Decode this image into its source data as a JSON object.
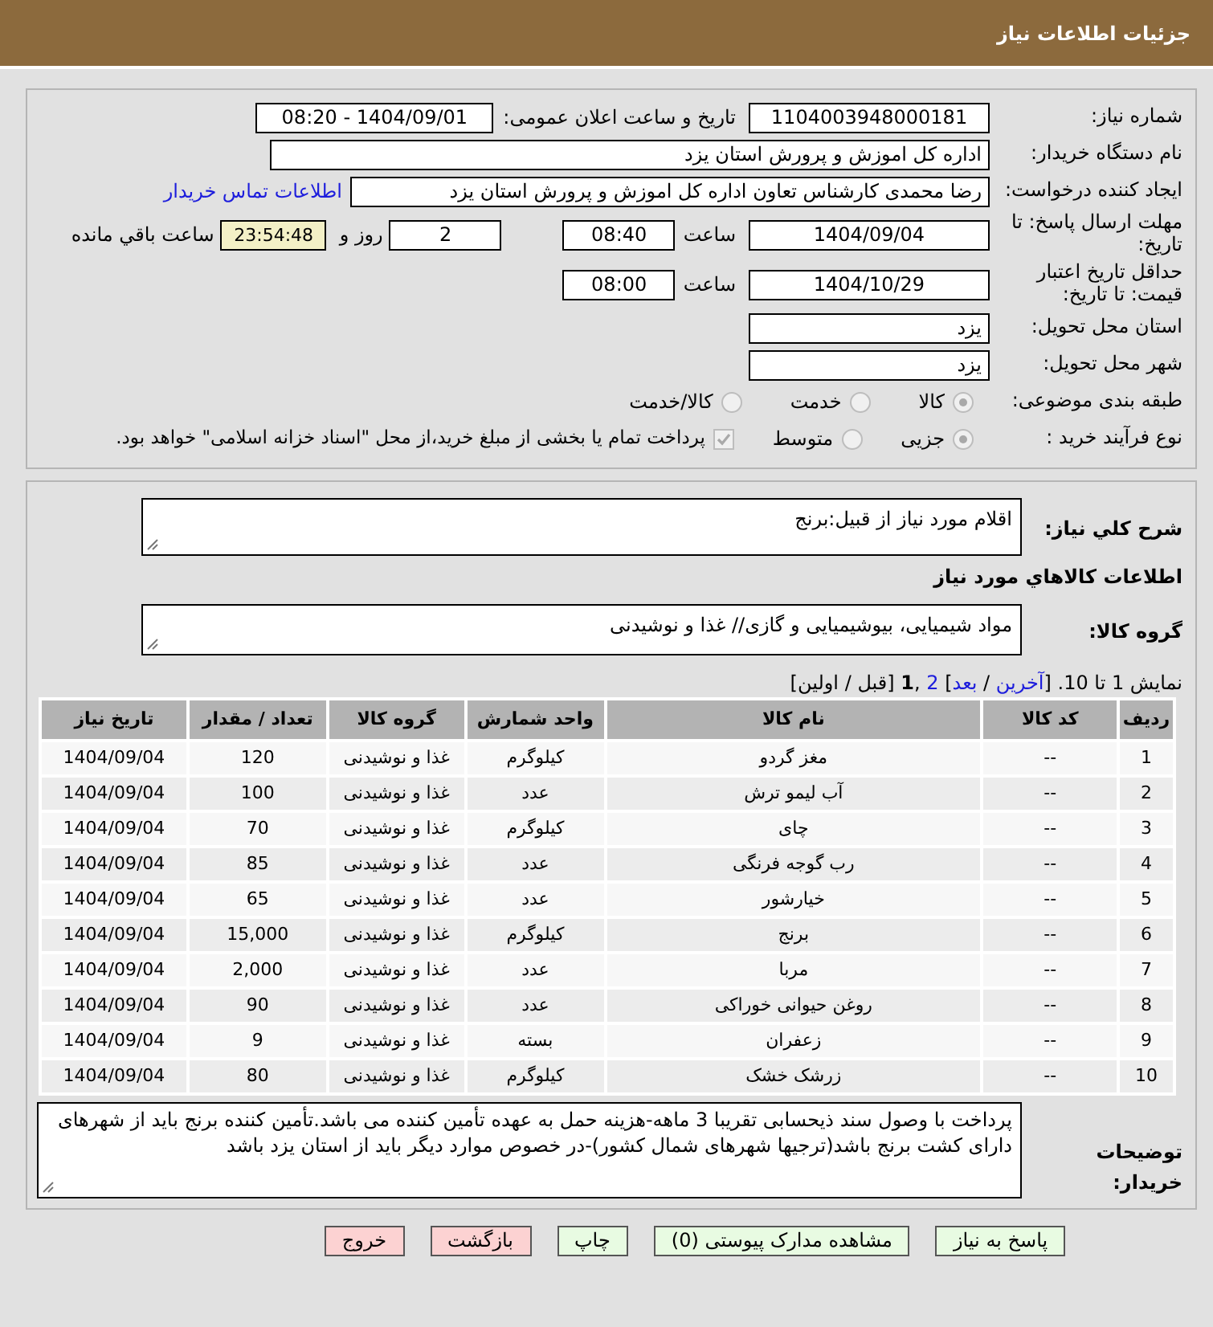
{
  "header": {
    "title": "جزئیات اطلاعات نیاز"
  },
  "need_number": {
    "label": "شماره نیاز:",
    "value": "1104003948000181"
  },
  "announce": {
    "label": "تاریخ و ساعت اعلان عمومی:",
    "value": "1404/09/01 - 08:20"
  },
  "buyer_org": {
    "label": "نام دستگاه خریدار:",
    "value": "اداره کل اموزش و پرورش استان یزد"
  },
  "requester": {
    "label": "ایجاد کننده درخواست:",
    "value": "رضا محمدی کارشناس تعاون اداره کل اموزش و پرورش استان یزد",
    "link": "اطلاعات تماس خریدار"
  },
  "deadline": {
    "label": "مهلت ارسال پاسخ: تا تاریخ:",
    "date": "1404/09/04",
    "time_label": "ساعت",
    "time": "08:40",
    "days": "2",
    "days_label": "روز و",
    "remaining": "23:54:48",
    "remaining_label": "ساعت باقي مانده"
  },
  "validity": {
    "label": "حداقل تاریخ اعتبار قیمت: تا تاریخ:",
    "date": "1404/10/29",
    "time_label": "ساعت",
    "time": "08:00"
  },
  "province": {
    "label": "استان محل تحویل:",
    "value": "یزد"
  },
  "city": {
    "label": "شهر محل تحویل:",
    "value": "یزد"
  },
  "category": {
    "label": "طبقه بندی موضوعی:",
    "options": [
      {
        "label": "کالا",
        "selected": true
      },
      {
        "label": "خدمت",
        "selected": false
      },
      {
        "label": "کالا/خدمت",
        "selected": false
      }
    ]
  },
  "process": {
    "label": "نوع فرآیند خرید :",
    "options": [
      {
        "label": "جزیی",
        "selected": true
      },
      {
        "label": "متوسط",
        "selected": false
      }
    ],
    "treasury": {
      "checked": true,
      "label": "پرداخت تمام یا بخشی از مبلغ خرید،از محل \"اسناد خزانه اسلامی\" خواهد بود."
    }
  },
  "description": {
    "label": "شرح کلي نياز:",
    "value": "اقلام مورد نیاز از قبیل:برنج"
  },
  "goods_title": "اطلاعات کالاهاي مورد نياز",
  "goods_group": {
    "label": "گروه کالا:",
    "value": "مواد شیمیایی، بیوشیمیایی و  گازی// غذا و نوشیدنی"
  },
  "pagination": [
    {
      "kind": "text",
      "text": "نمایش 1 تا 10. ["
    },
    {
      "kind": "link",
      "text": "آخرین"
    },
    {
      "kind": "text",
      "text": " / "
    },
    {
      "kind": "link",
      "text": "بعد"
    },
    {
      "kind": "text",
      "text": "] "
    },
    {
      "kind": "link",
      "text": "2"
    },
    {
      "kind": "text",
      "text": " ,"
    },
    {
      "kind": "current",
      "text": "1"
    },
    {
      "kind": "text",
      "text": " [قبل / اولین]"
    }
  ],
  "table": {
    "columns": [
      "ردیف",
      "کد کالا",
      "نام کالا",
      "واحد شمارش",
      "گروه کالا",
      "تعداد / مقدار",
      "تاریخ نیاز"
    ],
    "rows": [
      [
        "1",
        "--",
        "مغز گردو",
        "کیلوگرم",
        "غذا و نوشیدنی",
        "120",
        "1404/09/04"
      ],
      [
        "2",
        "--",
        "آب لیمو ترش",
        "عدد",
        "غذا و نوشیدنی",
        "100",
        "1404/09/04"
      ],
      [
        "3",
        "--",
        "چای",
        "کیلوگرم",
        "غذا و نوشیدنی",
        "70",
        "1404/09/04"
      ],
      [
        "4",
        "--",
        "رب گوجه فرنگی",
        "عدد",
        "غذا و نوشیدنی",
        "85",
        "1404/09/04"
      ],
      [
        "5",
        "--",
        "خیارشور",
        "عدد",
        "غذا و نوشیدنی",
        "65",
        "1404/09/04"
      ],
      [
        "6",
        "--",
        "برنج",
        "کیلوگرم",
        "غذا و نوشیدنی",
        "15,000",
        "1404/09/04"
      ],
      [
        "7",
        "--",
        "مربا",
        "عدد",
        "غذا و نوشیدنی",
        "2,000",
        "1404/09/04"
      ],
      [
        "8",
        "--",
        "روغن حیوانی خوراکی",
        "عدد",
        "غذا و نوشیدنی",
        "90",
        "1404/09/04"
      ],
      [
        "9",
        "--",
        "زعفران",
        "بسته",
        "غذا و نوشیدنی",
        "9",
        "1404/09/04"
      ],
      [
        "10",
        "--",
        "زرشک خشک",
        "کیلوگرم",
        "غذا و نوشیدنی",
        "80",
        "1404/09/04"
      ]
    ]
  },
  "buyer_notes": {
    "label": "توضیحات خریدار:",
    "value": "پرداخت با وصول سند ذیحسابی تقریبا 3 ماهه-هزینه حمل به عهده تأمین کننده می باشد.تأمین کننده برنج باید از شهرهای دارای کشت برنج باشد(ترجیها شهرهای شمال کشور)-در خصوص موارد دیگر باید از استان یزد باشد"
  },
  "buttons": [
    {
      "label": "پاسخ به نیاز",
      "kind": "go"
    },
    {
      "label": "مشاهده مدارک پیوستی (0)",
      "kind": "go"
    },
    {
      "label": "چاپ",
      "kind": "go"
    },
    {
      "label": "بازگشت",
      "kind": "back"
    },
    {
      "label": "خروج",
      "kind": "back"
    }
  ]
}
